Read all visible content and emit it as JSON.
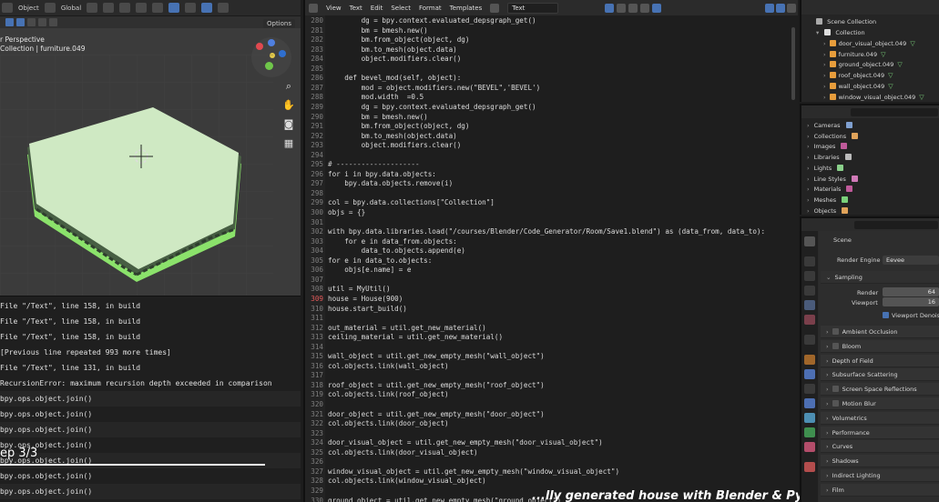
{
  "viewport": {
    "header_object": "Object",
    "header_global": "Global",
    "options_label": "Options",
    "perspective_label": "r Perspective",
    "collection_label": "Collection | furniture.049"
  },
  "console": {
    "lines": [
      "   File \"/Text\", line 158, in build",
      "   File \"/Text\", line 158, in build",
      "   File \"/Text\", line 158, in build",
      "   [Previous line repeated 993 more times]",
      "   File \"/Text\", line 131, in build",
      "RecursionError: maximum recursion depth exceeded in comparison",
      "bpy.ops.object.join()",
      "bpy.ops.object.join()",
      "bpy.ops.object.join()",
      "bpy.ops.object.join()",
      "bpy.ops.object.join()",
      "bpy.ops.object.join()",
      "bpy.ops.object.join()"
    ],
    "step_label": "ep 3/3"
  },
  "editor": {
    "menu": [
      "View",
      "Text",
      "Edit",
      "Select",
      "Format",
      "Templates"
    ],
    "file_name": "Text",
    "lines": [
      {
        "n": "280",
        "t": "        dg = bpy.context.evaluated_depsgraph_get()"
      },
      {
        "n": "281",
        "t": "        bm = bmesh.new()"
      },
      {
        "n": "282",
        "t": "        bm.from_object(object, dg)"
      },
      {
        "n": "283",
        "t": "        bm.to_mesh(object.data)"
      },
      {
        "n": "284",
        "t": "        object.modifiers.clear()"
      },
      {
        "n": "285",
        "t": ""
      },
      {
        "n": "286",
        "t": "    def bevel_mod(self, object):"
      },
      {
        "n": "287",
        "t": "        mod = object.modifiers.new(\"BEVEL\",'BEVEL')"
      },
      {
        "n": "288",
        "t": "        mod.width  =0.5"
      },
      {
        "n": "289",
        "t": "        dg = bpy.context.evaluated_depsgraph_get()"
      },
      {
        "n": "290",
        "t": "        bm = bmesh.new()"
      },
      {
        "n": "291",
        "t": "        bm.from_object(object, dg)"
      },
      {
        "n": "292",
        "t": "        bm.to_mesh(object.data)"
      },
      {
        "n": "293",
        "t": "        object.modifiers.clear()"
      },
      {
        "n": "294",
        "t": ""
      },
      {
        "n": "295",
        "t": "# --------------------"
      },
      {
        "n": "296",
        "t": "for i in bpy.data.objects:"
      },
      {
        "n": "297",
        "t": "    bpy.data.objects.remove(i)"
      },
      {
        "n": "298",
        "t": ""
      },
      {
        "n": "299",
        "t": "col = bpy.data.collections[\"Collection\"]"
      },
      {
        "n": "300",
        "t": "objs = {}"
      },
      {
        "n": "301",
        "t": ""
      },
      {
        "n": "302",
        "t": "with bpy.data.libraries.load(\"/courses/Blender/Code_Generator/Room/Save1.blend\") as (data_from, data_to):"
      },
      {
        "n": "303",
        "t": "    for e in data_from.objects:"
      },
      {
        "n": "304",
        "t": "        data_to.objects.append(e)"
      },
      {
        "n": "305",
        "t": "for e in data_to.objects:"
      },
      {
        "n": "306",
        "t": "    objs[e.name] = e"
      },
      {
        "n": "307",
        "t": ""
      },
      {
        "n": "308",
        "t": "util = MyUtil()"
      },
      {
        "n": "309",
        "t": "house = House(900)"
      },
      {
        "n": "310",
        "t": "house.start_build()"
      },
      {
        "n": "311",
        "t": ""
      },
      {
        "n": "312",
        "t": "out_material = util.get_new_material()"
      },
      {
        "n": "313",
        "t": "ceiling_material = util.get_new_material()"
      },
      {
        "n": "314",
        "t": ""
      },
      {
        "n": "315",
        "t": "wall_object = util.get_new_empty_mesh(\"wall_object\")"
      },
      {
        "n": "316",
        "t": "col.objects.link(wall_object)"
      },
      {
        "n": "317",
        "t": ""
      },
      {
        "n": "318",
        "t": "roof_object = util.get_new_empty_mesh(\"roof_object\")"
      },
      {
        "n": "319",
        "t": "col.objects.link(roof_object)"
      },
      {
        "n": "320",
        "t": ""
      },
      {
        "n": "321",
        "t": "door_object = util.get_new_empty_mesh(\"door_object\")"
      },
      {
        "n": "322",
        "t": "col.objects.link(door_object)"
      },
      {
        "n": "323",
        "t": ""
      },
      {
        "n": "324",
        "t": "door_visual_object = util.get_new_empty_mesh(\"door_visual_object\")"
      },
      {
        "n": "325",
        "t": "col.objects.link(door_visual_object)"
      },
      {
        "n": "326",
        "t": ""
      },
      {
        "n": "327",
        "t": "window_visual_object = util.get_new_empty_mesh(\"window_visual_object\")"
      },
      {
        "n": "328",
        "t": "col.objects.link(window_visual_object)"
      },
      {
        "n": "329",
        "t": ""
      },
      {
        "n": "330",
        "t": "ground_object = util.get_new_empty_mesh(\"ground_object\")"
      }
    ],
    "error_line": "309",
    "caption": "...lly generated house with Blender & Pytho"
  },
  "outliner": {
    "scene_collection": "Scene Collection",
    "collection": "Collection",
    "items": [
      "door_visual_object.049",
      "furniture.049",
      "ground_object.049",
      "roof_object.049",
      "wall_object.049",
      "window_visual_object.049"
    ]
  },
  "databrowser": {
    "items": [
      "Cameras",
      "Collections",
      "Images",
      "Libraries",
      "Lights",
      "Line Styles",
      "Materials",
      "Meshes",
      "Objects"
    ]
  },
  "properties": {
    "scene_label": "Scene",
    "render_engine_label": "Render Engine",
    "render_engine_value": "Eevee",
    "sampling_label": "Sampling",
    "render_label": "Render",
    "render_value": "64",
    "viewport_label": "Viewport",
    "viewport_value": "16",
    "viewport_denoising": "Viewport Denoising",
    "panels": [
      "Ambient Occlusion",
      "Bloom",
      "Depth of Field",
      "Subsurface Scattering",
      "Screen Space Reflections",
      "Motion Blur",
      "Volumetrics",
      "Performance",
      "Curves",
      "Shadows",
      "Indirect Lighting",
      "Film"
    ],
    "panels_with_checkbox": [
      "Ambient Occlusion",
      "Bloom",
      "Screen Space Reflections",
      "Motion Blur"
    ]
  }
}
